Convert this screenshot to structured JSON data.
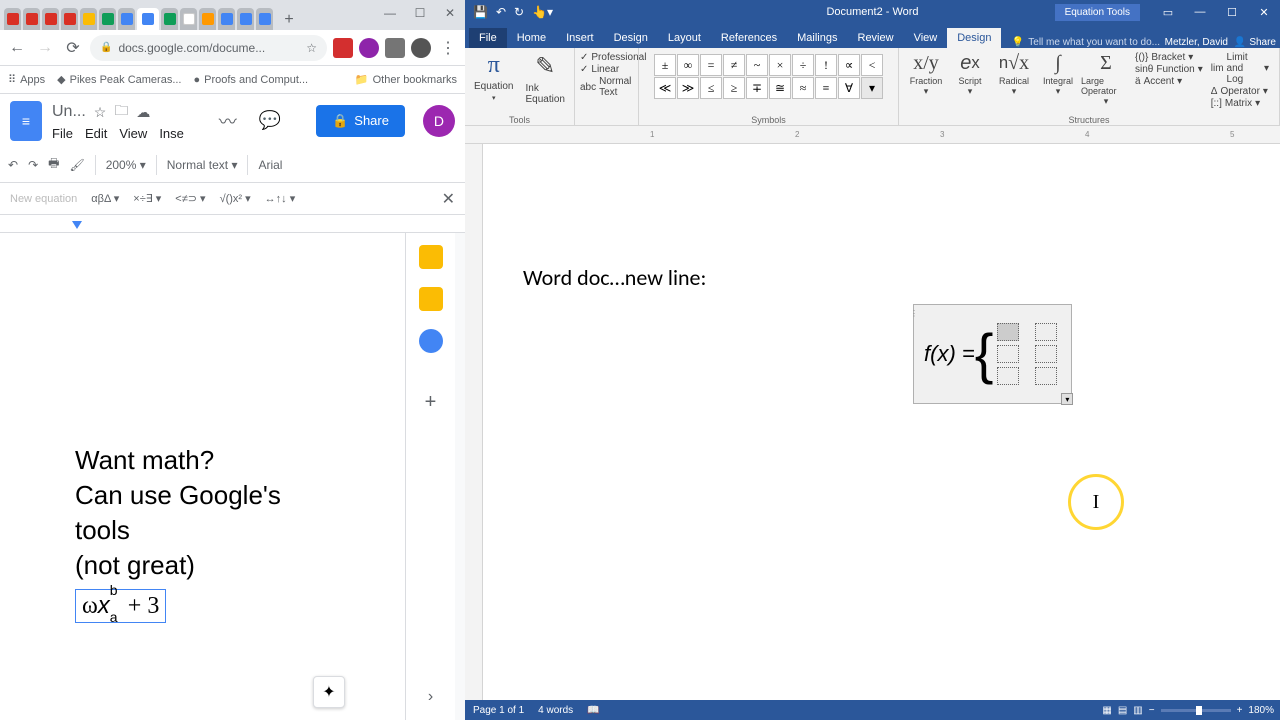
{
  "chrome": {
    "url": "docs.google.com/docume...",
    "bookmarks": {
      "apps": "Apps",
      "b1": "Pikes Peak Cameras...",
      "b2": "Proofs and Comput...",
      "other": "Other bookmarks"
    }
  },
  "docs": {
    "title": "Un...",
    "menu": {
      "file": "File",
      "edit": "Edit",
      "view": "View",
      "insert": "Inse"
    },
    "share": "Share",
    "avatar": "D",
    "toolbar": {
      "zoom": "200%",
      "style": "Normal text",
      "font": "Arial"
    },
    "eq_toolbar": {
      "new_eq": "New equation",
      "greek": "αβΔ",
      "ops": "×÷∃",
      "rel": "<≠⊃",
      "arrows": "√()x²",
      "misc": "↔↑↓"
    },
    "content": {
      "line1": "Want math?",
      "line2": "Can use Google's tools",
      "line3": "(not great)",
      "equation": "ωx + 3",
      "eq_sup": "b",
      "eq_sub": "a"
    }
  },
  "word": {
    "title": "Document2 - Word",
    "eq_tools": "Equation Tools",
    "user": "Metzler, David",
    "share": "Share",
    "tell_me": "Tell me what you want to do...",
    "tabs": {
      "file": "File",
      "home": "Home",
      "insert": "Insert",
      "design_main": "Design",
      "layout": "Layout",
      "references": "References",
      "mailings": "Mailings",
      "review": "Review",
      "view": "View",
      "design": "Design"
    },
    "ribbon": {
      "equation": "Equation",
      "ink_equation": "Ink Equation",
      "professional": "Professional",
      "linear": "Linear",
      "normal_text": "Normal Text",
      "tools": "Tools",
      "symbols_label": "Symbols",
      "structures": "Structures",
      "fraction": "Fraction",
      "script": "Script",
      "radical": "Radical",
      "integral": "Integral",
      "large_op": "Large Operator",
      "bracket": "Bracket",
      "limit": "Limit and Log",
      "operator": "Operator",
      "function": "Function",
      "accent": "Accent",
      "matrix": "Matrix"
    },
    "symbols": [
      "±",
      "∞",
      "=",
      "≠",
      "~",
      "×",
      "÷",
      "!",
      "∝",
      "<",
      "≪",
      "≫",
      "≤",
      "≥",
      "∓",
      "≅",
      "≈",
      "≡",
      "∀"
    ],
    "content": {
      "line1": "Word doc…new line:",
      "eq_lhs": "f(x) ="
    },
    "status": {
      "page": "Page 1 of 1",
      "words": "4 words",
      "zoom": "180%"
    }
  }
}
